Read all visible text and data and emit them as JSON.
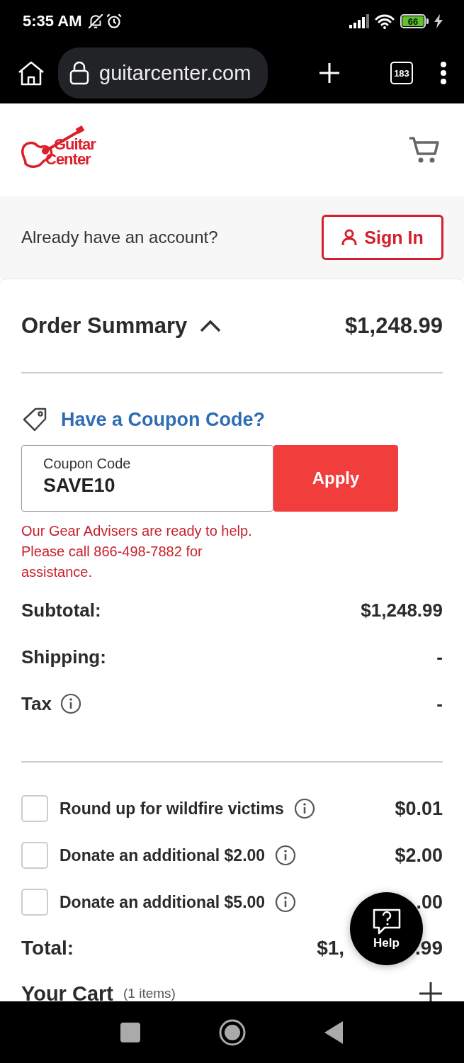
{
  "status_bar": {
    "time": "5:35 AM",
    "battery": "66"
  },
  "browser": {
    "url": "guitarcenter.com",
    "tab_count": "183"
  },
  "logo": {
    "line_1": "Guitar",
    "line_2": "Center"
  },
  "account_prompt": {
    "text": "Already have an account?",
    "button": "Sign In"
  },
  "order_summary": {
    "title": "Order Summary",
    "expanded": true,
    "amount": "$1,248.99"
  },
  "coupon": {
    "link": "Have a Coupon Code?",
    "label": "Coupon Code",
    "value": "SAVE10",
    "button": "Apply",
    "message": "Our Gear Advisers are ready to help. Please call 866-498-7882 for assistance."
  },
  "lines": [
    {
      "label": "Subtotal:",
      "value": "$1,248.99",
      "info": false
    },
    {
      "label": "Shipping:",
      "value": "-",
      "info": false
    },
    {
      "label": "Tax",
      "value": "-",
      "info": true
    }
  ],
  "donations": [
    {
      "label": "Round up for wildfire victims",
      "amount": "$0.01",
      "checked": false
    },
    {
      "label": "Donate an additional $2.00",
      "amount": "$2.00",
      "checked": false
    },
    {
      "label": "Donate an additional $5.00",
      "amount": ".00",
      "checked": false
    }
  ],
  "total": {
    "label": "Total:",
    "value_left": "$1,",
    "value_right": ".99"
  },
  "cart": {
    "title": "Your Cart",
    "count": "(1 items)",
    "expanded": false
  },
  "help": {
    "label": "Help"
  }
}
